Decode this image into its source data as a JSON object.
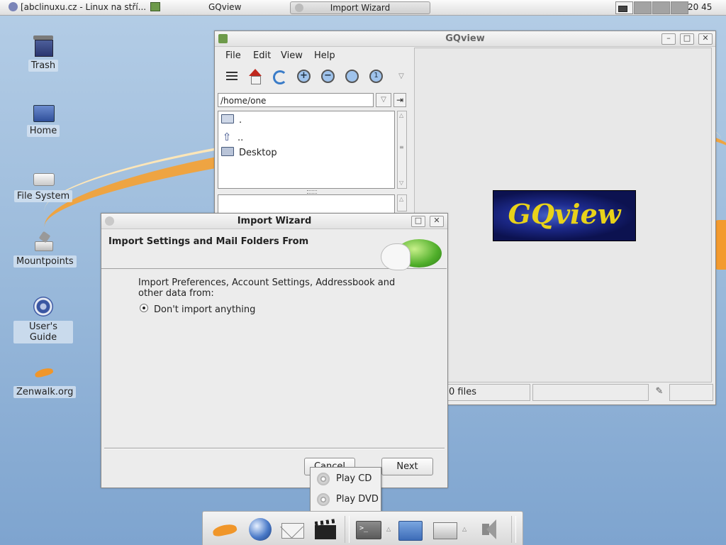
{
  "top_panel": {
    "tasks": [
      "[abclinuxu.cz - Linux na stří...",
      "GQview",
      "Import Wizard"
    ],
    "clock": "20 45",
    "workspaces": 4
  },
  "desktop": {
    "icons": [
      "Trash",
      "Home",
      "File System",
      "Mountpoints",
      "User's Guide",
      "Zenwalk.org"
    ]
  },
  "gqview": {
    "title": "GQview",
    "menus": [
      "File",
      "Edit",
      "View",
      "Help"
    ],
    "path": "/home/one",
    "dirs": [
      ".",
      "..",
      "Desktop"
    ],
    "logo_text": "GQview",
    "status": {
      "files": "0 files"
    }
  },
  "wizard": {
    "title": "Import Wizard",
    "heading": "Import Settings and Mail Folders From",
    "body": "Import Preferences, Account Settings, Addressbook and other data from:",
    "option": "Don't import anything",
    "cancel": "Cancel",
    "next": "Next"
  },
  "popup": {
    "items": [
      "Play CD",
      "Play DVD"
    ]
  },
  "colors": {
    "swoosh": "#f3a33a",
    "logo_text": "#e8d21a",
    "logo_bg": "#1d2a8c"
  }
}
